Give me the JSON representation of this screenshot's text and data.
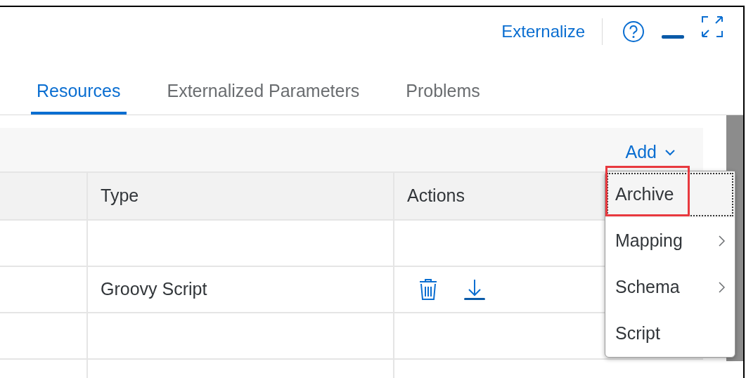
{
  "header": {
    "link": "Externalize"
  },
  "tabs": [
    {
      "label": "Resources",
      "selected": true
    },
    {
      "label": "Externalized Parameters",
      "selected": false
    },
    {
      "label": "Problems",
      "selected": false
    }
  ],
  "add_button": {
    "label": "Add"
  },
  "table": {
    "columns": [
      {
        "label": "Type"
      },
      {
        "label": "Actions"
      }
    ],
    "rows": [
      {
        "has_actions": false
      },
      {
        "type": "Groovy Script",
        "has_actions": true
      },
      {
        "has_actions": false
      },
      {
        "has_actions": false
      }
    ]
  },
  "menu": {
    "items": [
      {
        "label": "Archive",
        "submenu": false,
        "focused": true,
        "highlighted": true
      },
      {
        "label": "Mapping",
        "submenu": true,
        "focused": false,
        "highlighted": false
      },
      {
        "label": "Schema",
        "submenu": true,
        "focused": false,
        "highlighted": false
      },
      {
        "label": "Script",
        "submenu": false,
        "focused": false,
        "highlighted": false
      }
    ]
  }
}
